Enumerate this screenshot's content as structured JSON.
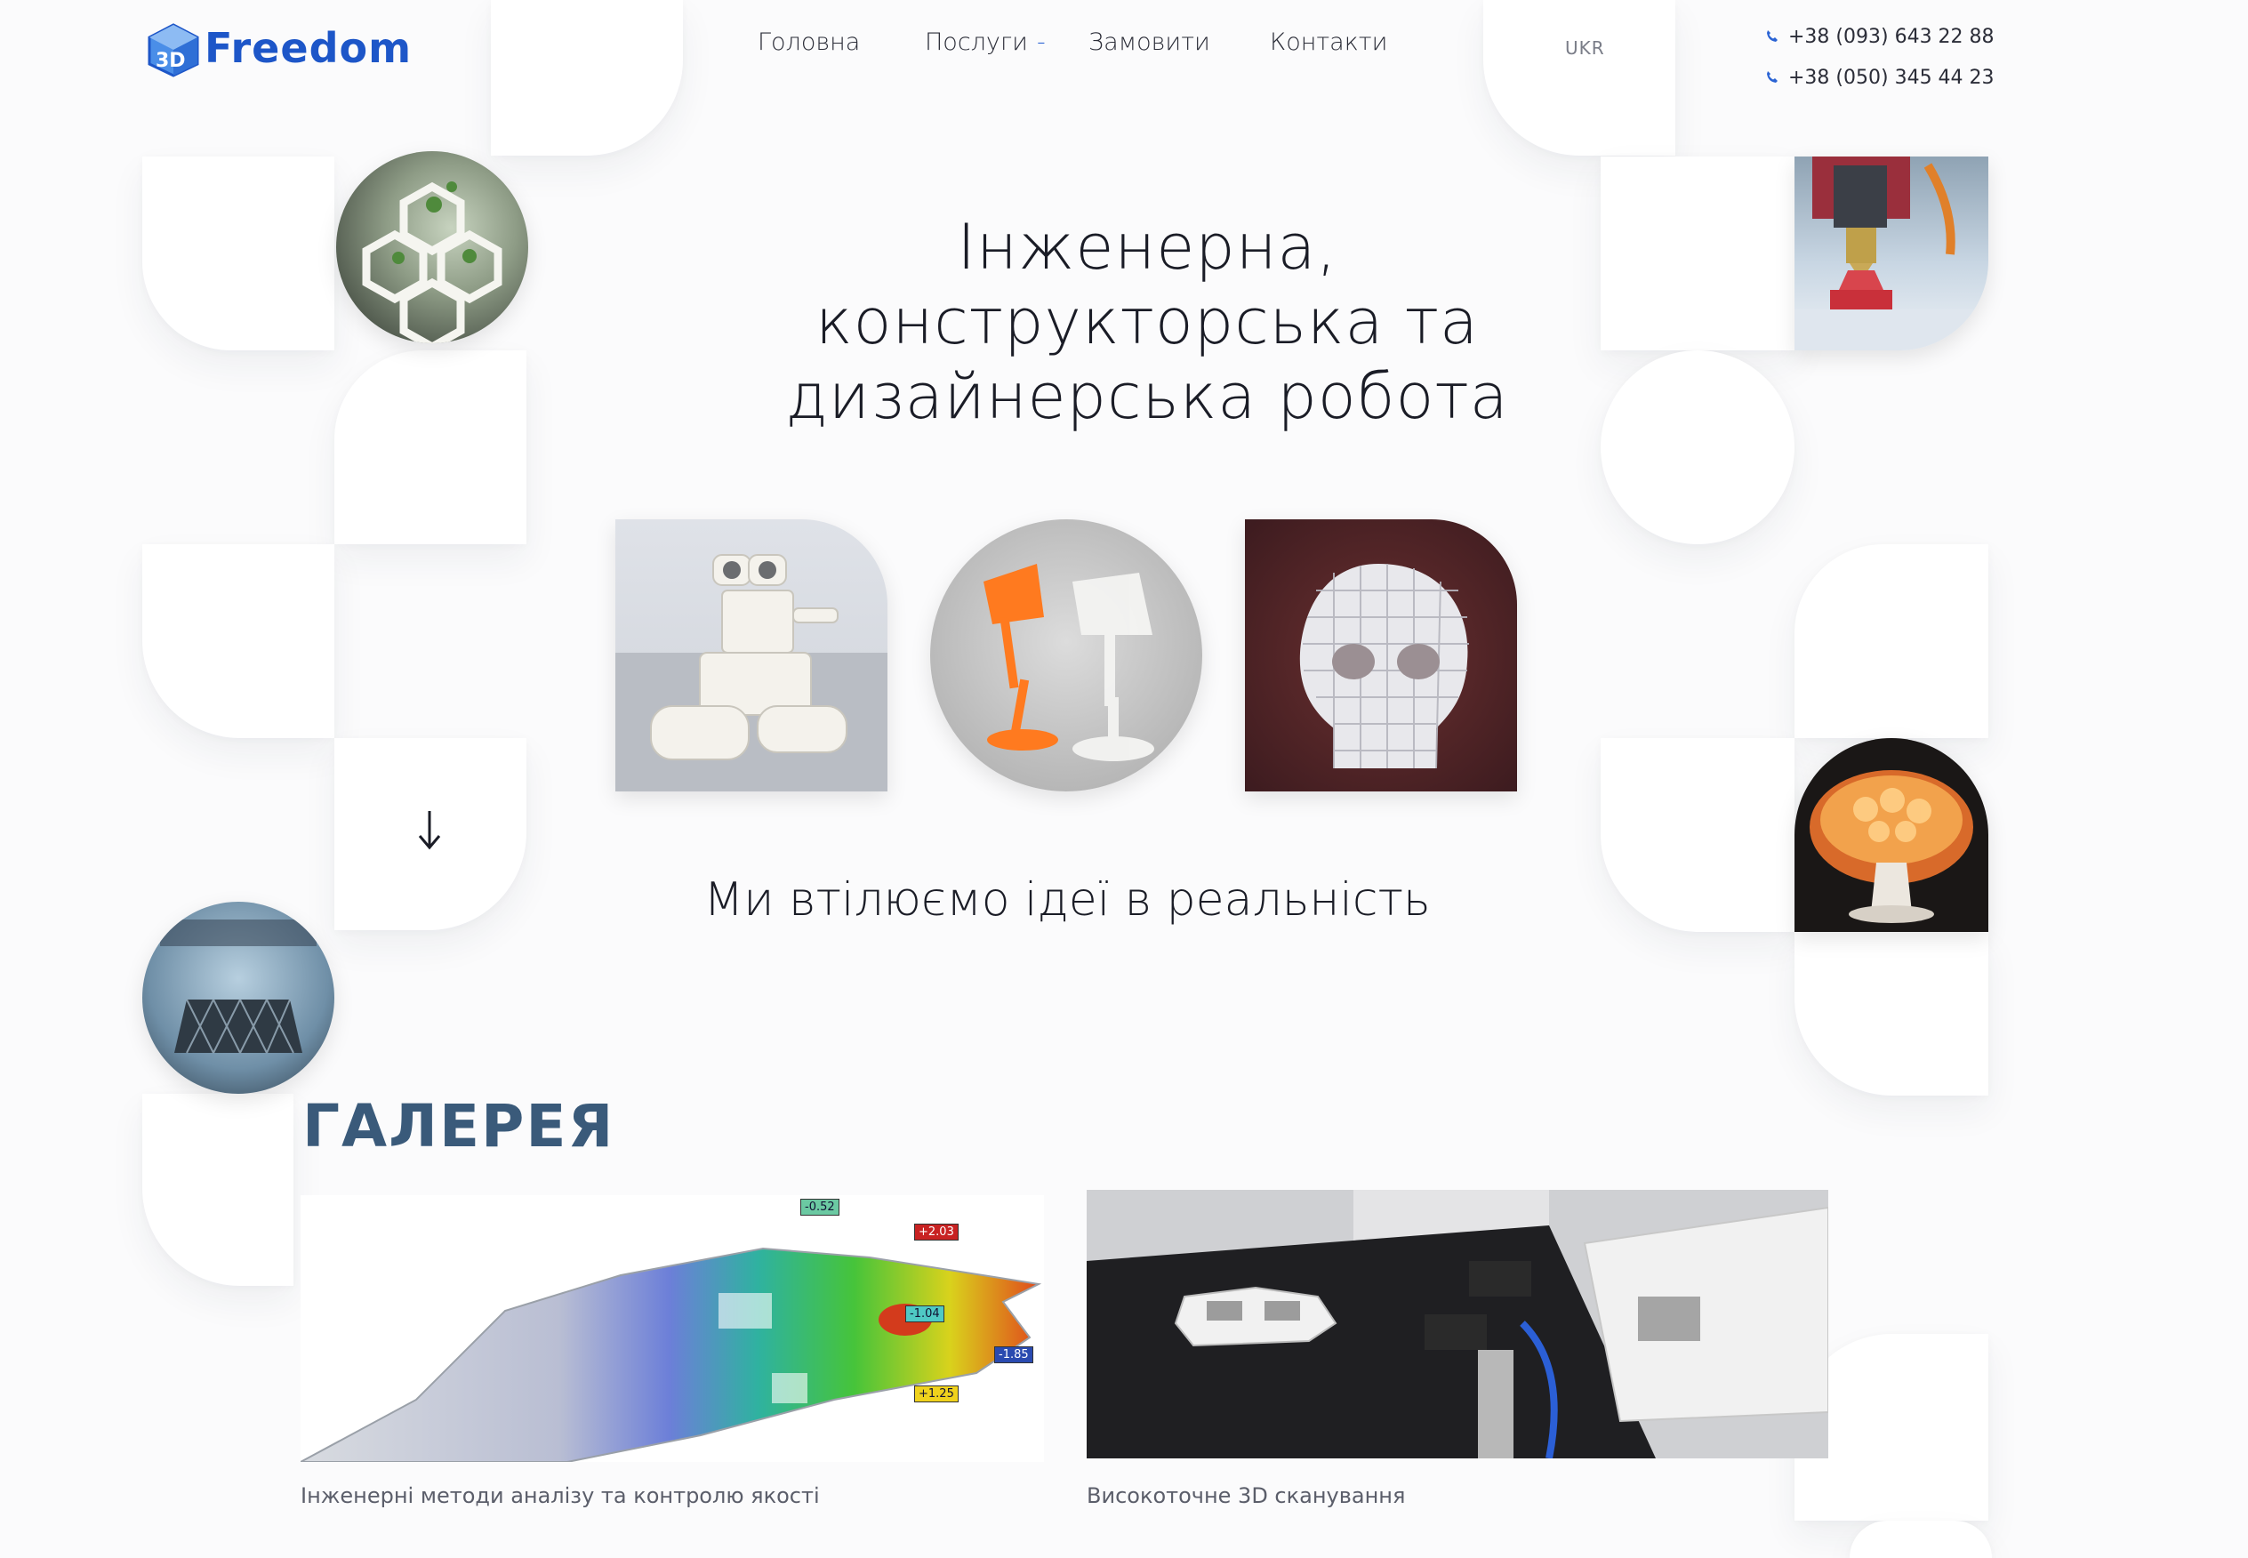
{
  "brand": {
    "logo_prefix": "3D",
    "logo_word": "Freedom",
    "accent": "#1d56c8"
  },
  "nav": {
    "items": [
      {
        "label": "Головна"
      },
      {
        "label": "Послуги",
        "has_dropdown": true
      },
      {
        "label": "Замовити"
      },
      {
        "label": "Контакти"
      }
    ],
    "dropdown_caret": "-",
    "language": "UKR"
  },
  "contacts": {
    "phones": [
      "+38 (093) 643 22 88",
      "+38 (050) 345 44 23"
    ],
    "icon": "phone-icon"
  },
  "hero": {
    "title_lines": [
      "Інженерна,",
      "конструкторська та",
      "дизайнерська робота"
    ],
    "slogan": "Ми втілюємо ідеї в реальність",
    "scroll_icon": "arrow-down-icon"
  },
  "gallery": {
    "title": "ГАЛЕРЕЯ",
    "items": [
      {
        "caption": "Інженерні методи аналізу та контролю якості"
      },
      {
        "caption": "Високоточне 3D сканування"
      }
    ]
  },
  "analysis_labels": [
    "-0.52",
    "+2.03",
    "-1.04",
    "-1.85",
    "+1.25"
  ]
}
